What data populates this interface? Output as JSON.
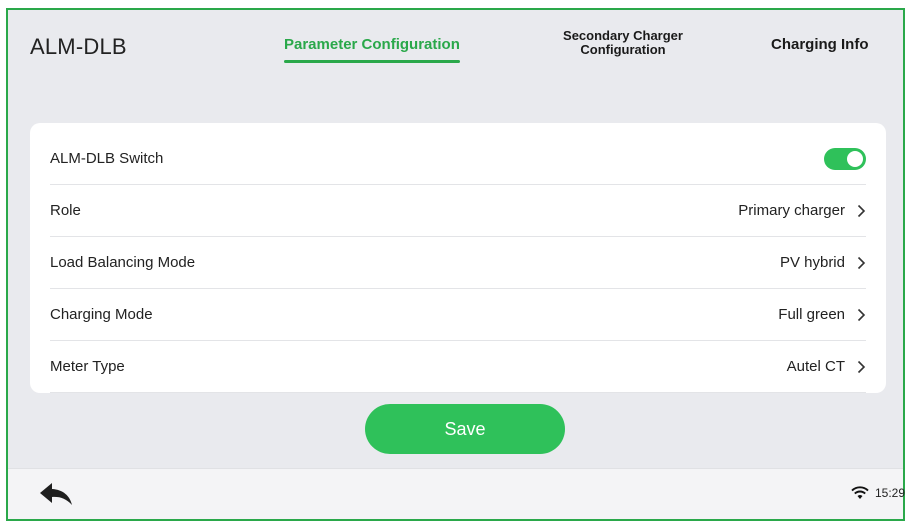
{
  "header": {
    "app_title": "ALM-DLB",
    "tabs": [
      {
        "label": "Parameter Configuration",
        "active": true
      },
      {
        "label_line1": "Secondary Charger",
        "label_line2": "Configuration",
        "active": false
      },
      {
        "label": "Charging Info",
        "active": false
      }
    ]
  },
  "settings": {
    "switch_label": "ALM-DLB Switch",
    "switch_on": true,
    "rows": [
      {
        "label": "Role",
        "value": "Primary charger"
      },
      {
        "label": "Load Balancing Mode",
        "value": "PV hybrid"
      },
      {
        "label": "Charging Mode",
        "value": "Full green"
      },
      {
        "label": "Meter Type",
        "value": "Autel CT"
      }
    ]
  },
  "actions": {
    "save_label": "Save"
  },
  "status_bar": {
    "time": "15:29",
    "wifi_icon": "wifi-icon",
    "back_icon": "back-arrow-icon"
  },
  "colors": {
    "accent": "#2fc15a",
    "border": "#2aa84a",
    "background": "#e9eaee"
  }
}
